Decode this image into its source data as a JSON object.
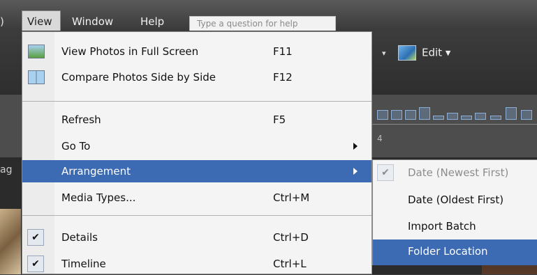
{
  "menubar": {
    "items": [
      "View",
      "Window",
      "Help"
    ],
    "search_placeholder": "Type a question for help",
    "left_fragment": ")"
  },
  "toolbar": {
    "edit_label": "Edit ▾",
    "arrow_label": "▾"
  },
  "background": {
    "left_fragment": "ag",
    "ruler_label": "4"
  },
  "view_menu": {
    "items": [
      {
        "label": "View Photos in Full Screen",
        "shortcut": "F11",
        "icon": "fullscreen-icon"
      },
      {
        "label": "Compare Photos Side by Side",
        "shortcut": "F12",
        "icon": "compare-icon"
      },
      {
        "label": "Refresh",
        "shortcut": "F5"
      },
      {
        "label": "Go To",
        "shortcut": "",
        "submenu": true
      },
      {
        "label": "Arrangement",
        "shortcut": "",
        "submenu": true,
        "highlighted": true
      },
      {
        "label": "Media Types...",
        "shortcut": "Ctrl+M"
      },
      {
        "label": "Details",
        "shortcut": "Ctrl+D",
        "checked": true
      },
      {
        "label": "Timeline",
        "shortcut": "Ctrl+L",
        "checked": true
      }
    ]
  },
  "arrangement_submenu": {
    "items": [
      {
        "label": "Date (Newest First)",
        "checked": true,
        "disabled": true
      },
      {
        "label": "Date (Oldest First)"
      },
      {
        "label": "Import Batch"
      },
      {
        "label": "Folder Location",
        "highlighted": true
      }
    ]
  },
  "colors": {
    "highlight": "#3c6ab3",
    "menu_bg": "#f4f4f4",
    "menubar_bg": "#4a4a4a"
  }
}
